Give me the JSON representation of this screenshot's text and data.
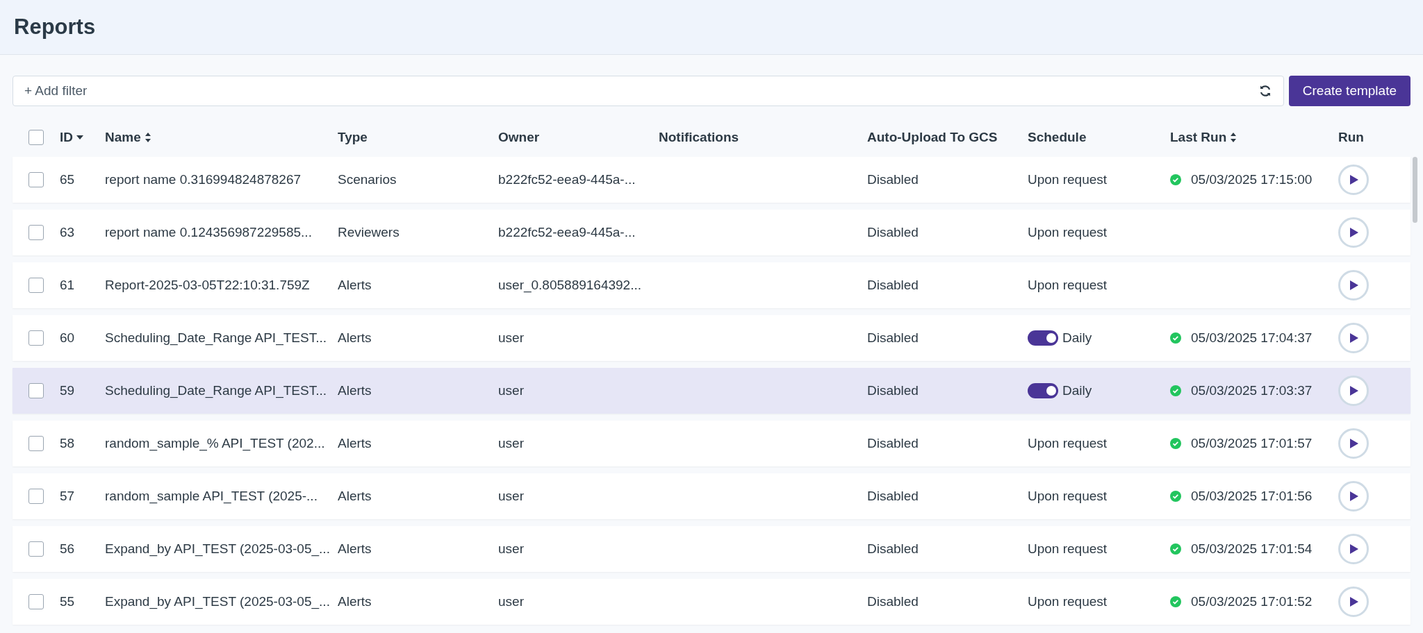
{
  "page": {
    "title": "Reports"
  },
  "filter": {
    "placeholder": "+ Add filter"
  },
  "create_button": "Create template",
  "table": {
    "select_all": {
      "checked": false
    },
    "columns": [
      {
        "label": "ID",
        "sortable": true,
        "sorted": true
      },
      {
        "label": "Name",
        "sortable": true,
        "sorted": false
      },
      {
        "label": "Type",
        "sortable": false
      },
      {
        "label": "Owner",
        "sortable": false
      },
      {
        "label": "Notifications",
        "sortable": false
      },
      {
        "label": "Auto-Upload To GCS",
        "sortable": false
      },
      {
        "label": "Schedule",
        "sortable": false
      },
      {
        "label": "Last Run",
        "sortable": true,
        "sorted": false
      },
      {
        "label": "Run",
        "sortable": false
      }
    ],
    "rows": [
      {
        "checked": false,
        "highlighted": false,
        "id": "65",
        "name": "report name 0.316994824878267",
        "type": "Scenarios",
        "owner": "b222fc52-eea9-445a-...",
        "upload": "Disabled",
        "schedule": {
          "kind": "text",
          "label": "Upon request"
        },
        "last_run": {
          "ok": true,
          "text": "05/03/2025 17:15:00"
        }
      },
      {
        "checked": false,
        "highlighted": false,
        "id": "63",
        "name": "report name 0.124356987229585...",
        "type": "Reviewers",
        "owner": "b222fc52-eea9-445a-...",
        "upload": "Disabled",
        "schedule": {
          "kind": "text",
          "label": "Upon request"
        }
      },
      {
        "checked": false,
        "highlighted": false,
        "id": "61",
        "name": "Report-2025-03-05T22:10:31.759Z",
        "type": "Alerts",
        "owner": "user_0.805889164392...",
        "upload": "Disabled",
        "schedule": {
          "kind": "text",
          "label": "Upon request"
        }
      },
      {
        "checked": false,
        "highlighted": false,
        "id": "60",
        "name": "Scheduling_Date_Range API_TEST...",
        "type": "Alerts",
        "owner": "user",
        "upload": "Disabled",
        "schedule": {
          "kind": "toggle",
          "on": true,
          "label": "Daily"
        },
        "last_run": {
          "ok": true,
          "text": "05/03/2025 17:04:37"
        }
      },
      {
        "checked": false,
        "highlighted": true,
        "id": "59",
        "name": "Scheduling_Date_Range API_TEST...",
        "type": "Alerts",
        "owner": "user",
        "upload": "Disabled",
        "schedule": {
          "kind": "toggle",
          "on": true,
          "label": "Daily"
        },
        "last_run": {
          "ok": true,
          "text": "05/03/2025 17:03:37"
        }
      },
      {
        "checked": false,
        "highlighted": false,
        "id": "58",
        "name": "random_sample_% API_TEST (202...",
        "type": "Alerts",
        "owner": "user",
        "upload": "Disabled",
        "schedule": {
          "kind": "text",
          "label": "Upon request"
        },
        "last_run": {
          "ok": true,
          "text": "05/03/2025 17:01:57"
        }
      },
      {
        "checked": false,
        "highlighted": false,
        "id": "57",
        "name": "random_sample API_TEST (2025-...",
        "type": "Alerts",
        "owner": "user",
        "upload": "Disabled",
        "schedule": {
          "kind": "text",
          "label": "Upon request"
        },
        "last_run": {
          "ok": true,
          "text": "05/03/2025 17:01:56"
        }
      },
      {
        "checked": false,
        "highlighted": false,
        "id": "56",
        "name": "Expand_by API_TEST (2025-03-05_...",
        "type": "Alerts",
        "owner": "user",
        "upload": "Disabled",
        "schedule": {
          "kind": "text",
          "label": "Upon request"
        },
        "last_run": {
          "ok": true,
          "text": "05/03/2025 17:01:54"
        }
      },
      {
        "checked": false,
        "highlighted": false,
        "id": "55",
        "name": "Expand_by API_TEST (2025-03-05_...",
        "type": "Alerts",
        "owner": "user",
        "upload": "Disabled",
        "schedule": {
          "kind": "text",
          "label": "Upon request"
        },
        "last_run": {
          "ok": true,
          "text": "05/03/2025 17:01:52"
        }
      }
    ]
  }
}
